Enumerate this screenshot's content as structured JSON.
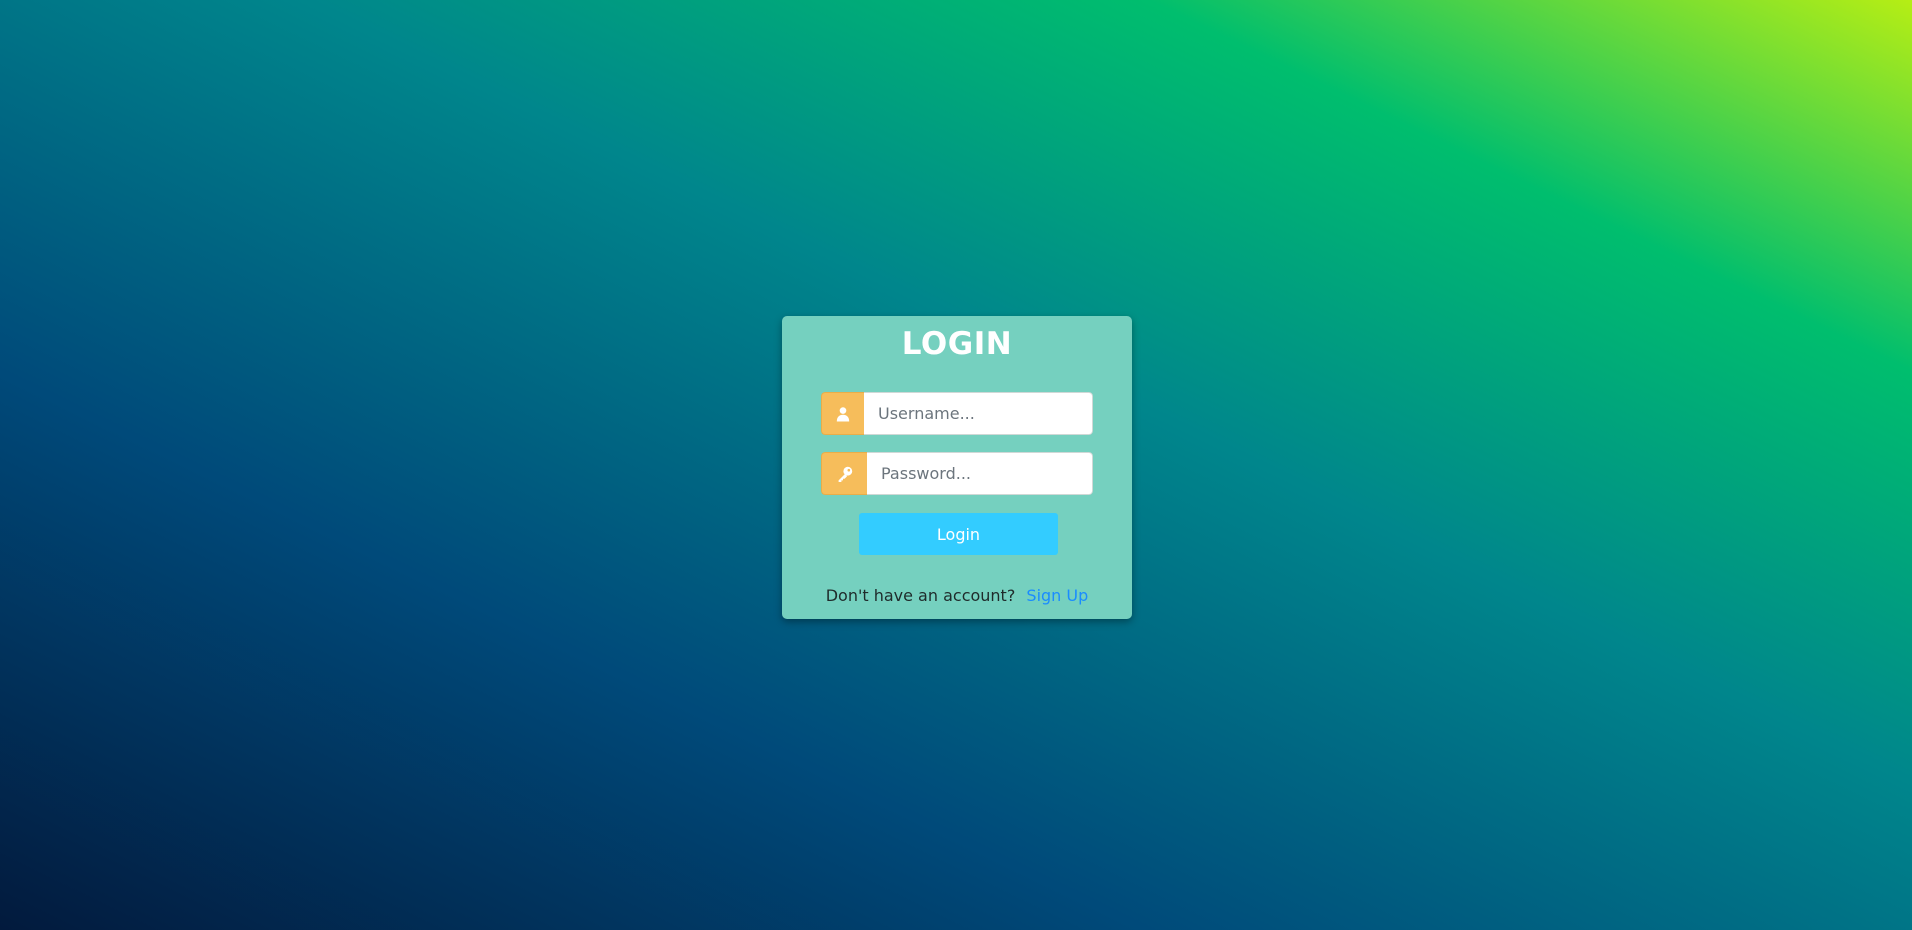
{
  "login_card": {
    "title": "LOGIN",
    "username": {
      "value": "",
      "placeholder": "Username...",
      "icon": "user-icon"
    },
    "password": {
      "value": "",
      "placeholder": "Password...",
      "icon": "key-icon"
    },
    "login_button_label": "Login",
    "signup_prompt": "Don't have an account?",
    "signup_link_label": "Sign Up"
  },
  "colors": {
    "card_background": "#75d0bf",
    "icon_prefix_background": "#f6bd5b",
    "login_button": "#33ccff",
    "signup_link": "#1a8cff"
  }
}
